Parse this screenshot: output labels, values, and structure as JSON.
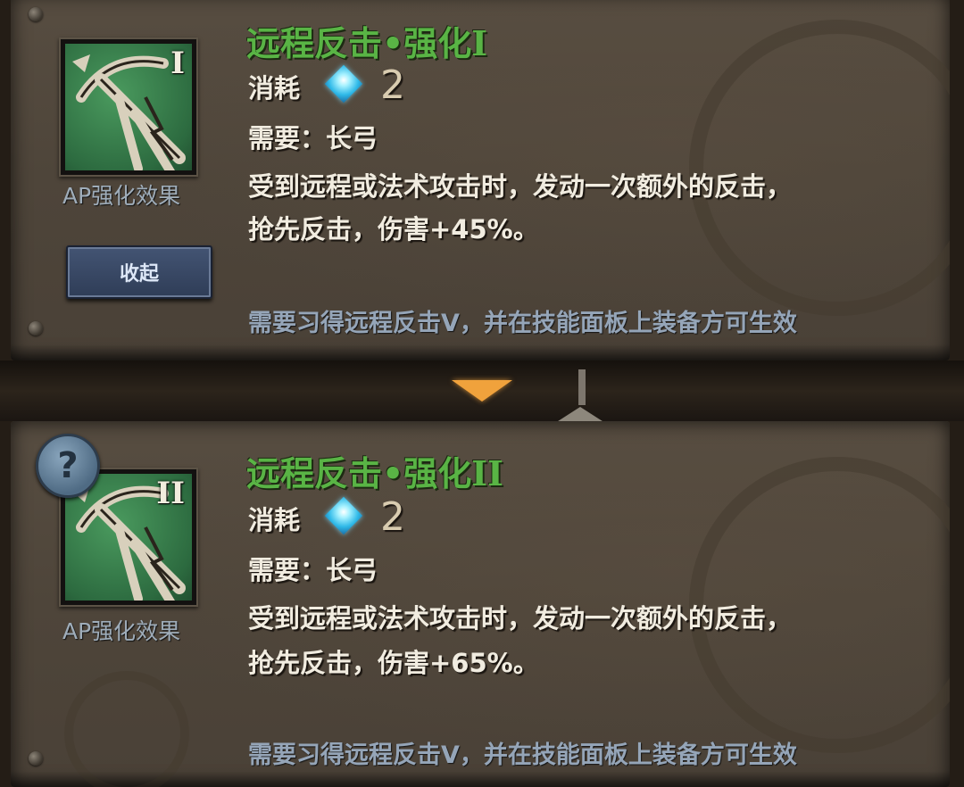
{
  "cards": [
    {
      "rank": "I",
      "title": "远程反击•强化I",
      "cost_label": "消耗",
      "cost_value": "2",
      "requirement": "需要：长弓",
      "desc_line1": "受到远程或法术攻击时，发动一次额外的反击，",
      "desc_line2": "抢先反击，伤害+45%。",
      "ap_label": "AP强化效果",
      "collapse_label": "收起",
      "note": "需要习得远程反击V，并在技能面板上装备方可生效"
    },
    {
      "rank": "II",
      "title": "远程反击•强化II",
      "cost_label": "消耗",
      "cost_value": "2",
      "requirement": "需要：长弓",
      "desc_line1": "受到远程或法术攻击时，发动一次额外的反击，",
      "desc_line2": "抢先反击，伤害+65%。",
      "ap_label": "AP强化效果",
      "note": "需要习得远程反击V，并在技能面板上装备方可生效"
    }
  ],
  "help_glyph": "?",
  "colors": {
    "title_green": "#59b445",
    "note_blue": "#95a5b8",
    "gem_cyan": "#2fb9e8",
    "arrow_orange": "#f0a23c"
  },
  "icons": {
    "skill": "longbow-icon",
    "cost": "crystal-gem-icon",
    "help": "question-icon",
    "expand": "arrow-down-icon"
  }
}
